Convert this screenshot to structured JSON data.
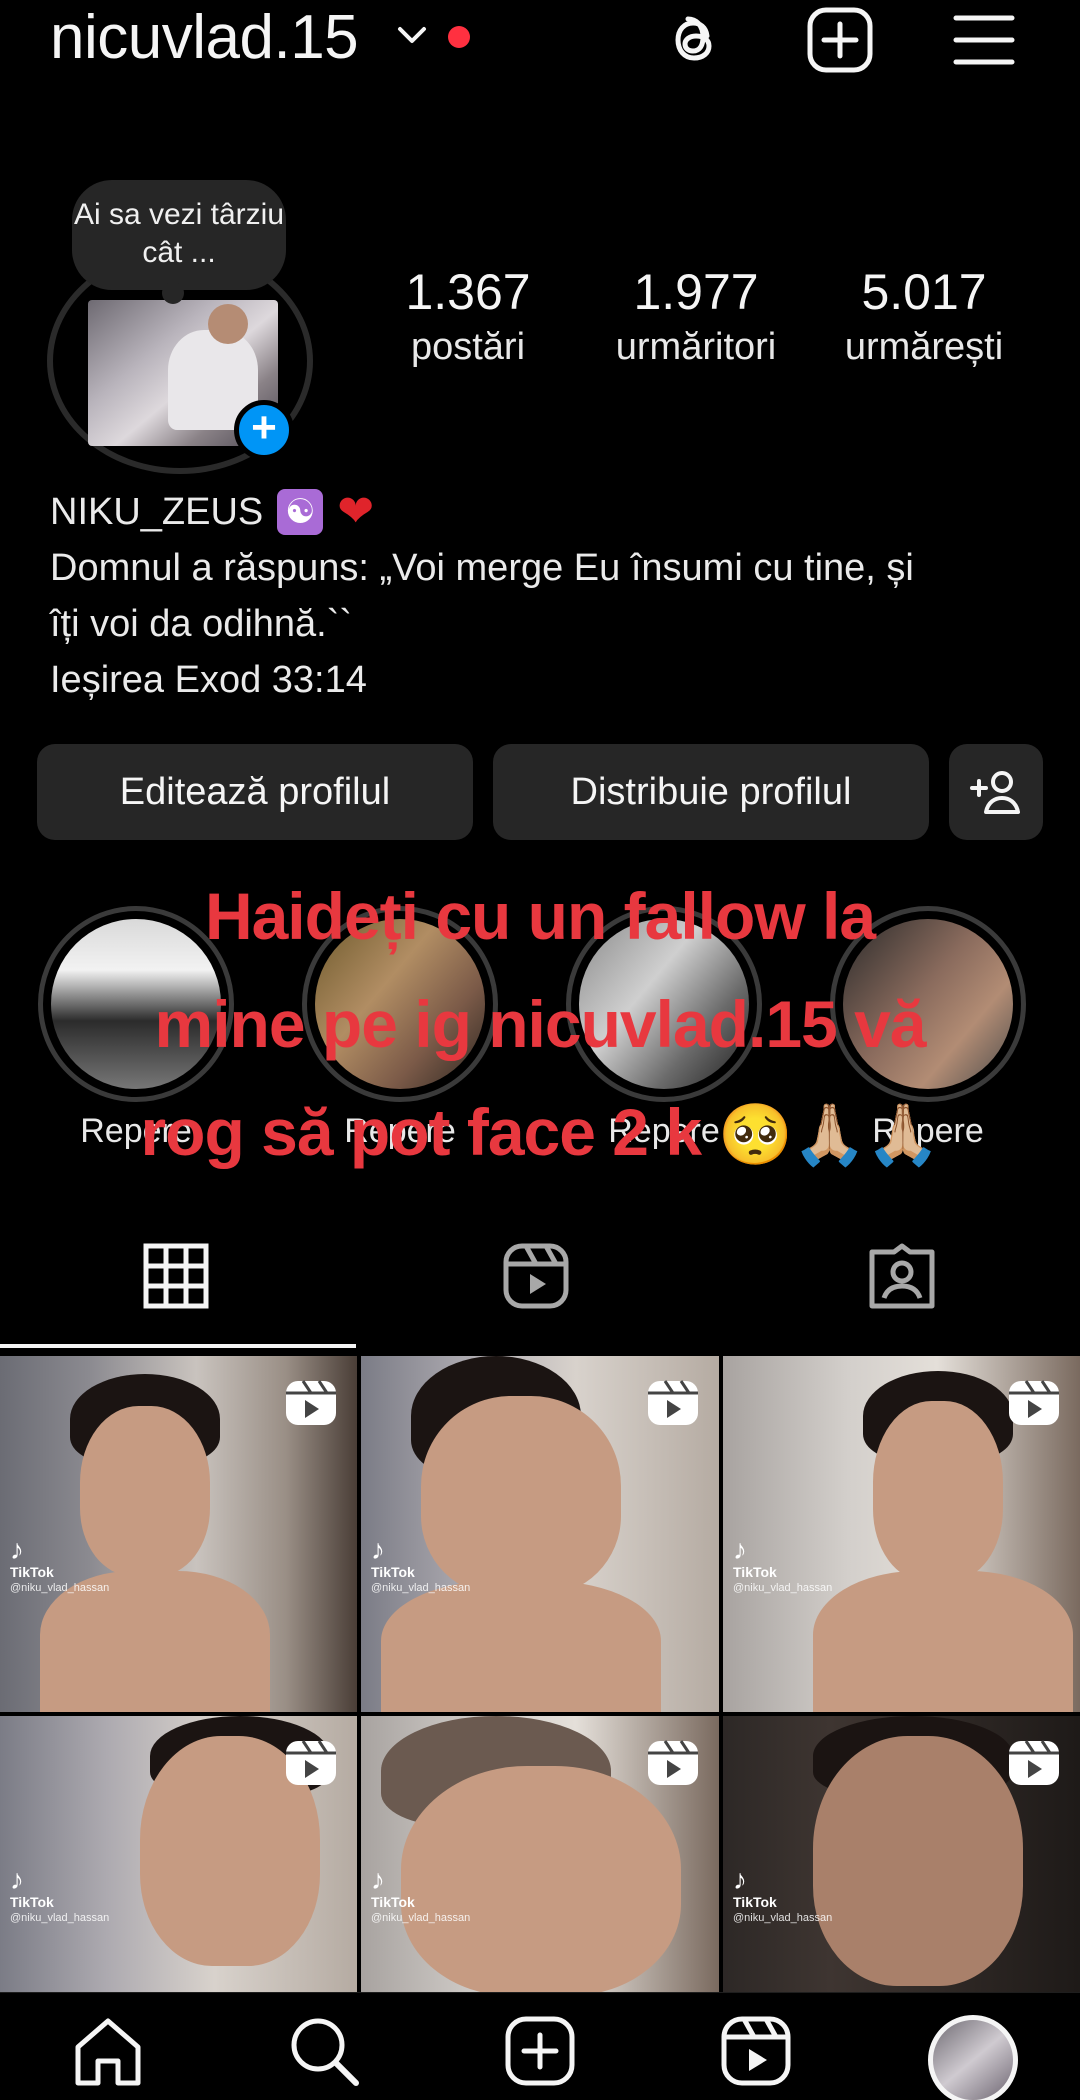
{
  "header": {
    "username": "nicuvlad.15",
    "icons": [
      "chevron-down-icon",
      "threads-icon",
      "create-icon",
      "menu-icon"
    ],
    "notification_color": "#ff3040"
  },
  "profile": {
    "note": "Ai sa vezi târziu cât ...",
    "stats": [
      {
        "value": "1.367",
        "label": "postări"
      },
      {
        "value": "1.977",
        "label": "urmăritori"
      },
      {
        "value": "5.017",
        "label": "urmărești"
      }
    ],
    "display_name": "NIKU_ZEUS",
    "bio_line1": "Domnul a răspuns: „Voi merge Eu însumi cu tine, și",
    "bio_line2": "îți voi da odihnă.``",
    "bio_line3": "Ieșirea Exod 33:14"
  },
  "actions": {
    "edit_label": "Editează profilul",
    "share_label": "Distribuie profilul"
  },
  "highlights": [
    {
      "label": "Repere"
    },
    {
      "label": "Repere"
    },
    {
      "label": "Repere"
    },
    {
      "label": "Repere"
    }
  ],
  "overlay": {
    "line1": "Haideți  cu un fallow la",
    "line2": "mine pe ig nicuvlad.15 vă",
    "line3": "rog să pot face 2 k",
    "emojis": "🥺🙏🏼🙏🏼",
    "color": "#e8383f"
  },
  "tabs": [
    {
      "name": "grid",
      "icon": "grid-icon",
      "active": true
    },
    {
      "name": "reels",
      "icon": "reels-icon",
      "active": false
    },
    {
      "name": "tagged",
      "icon": "tagged-icon",
      "active": false
    }
  ],
  "posts": [
    {
      "watermark": "TikTok",
      "handle": "@niku_vlad_hassan"
    },
    {
      "watermark": "TikTok",
      "handle": "@niku_vlad_hassan"
    },
    {
      "watermark": "TikTok",
      "handle": "@niku_vlad_hassan"
    },
    {
      "watermark": "TikTok",
      "handle": "@niku_vlad_hassan"
    },
    {
      "watermark": "TikTok",
      "handle": "@niku_vlad_hassan"
    },
    {
      "watermark": "TikTok",
      "handle": "@niku_vlad_hassan"
    }
  ],
  "bottom_nav": [
    "home-icon",
    "search-icon",
    "create-icon",
    "reels-icon",
    "profile-avatar"
  ],
  "accent": "#0095f6"
}
